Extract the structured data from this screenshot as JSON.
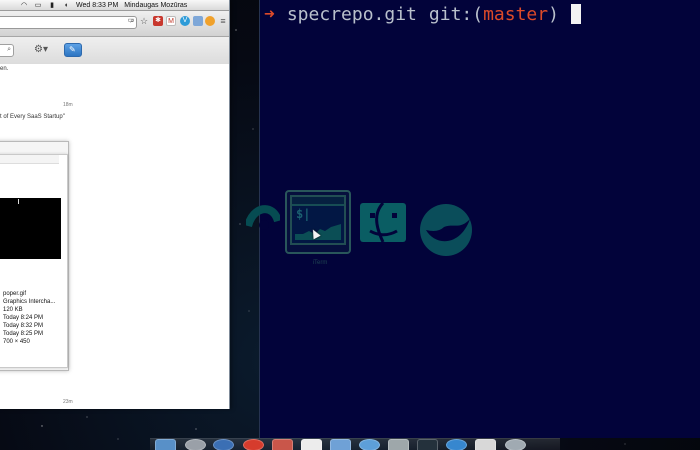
{
  "menubar": {
    "items": [
      "⎈",
      "⌂",
      "◫",
      "◐",
      "🔊"
    ],
    "time": "Wed 8:33 PM",
    "user": "Mindaugas Mozūras"
  },
  "left_window": {
    "address": "",
    "snippet": "en.",
    "timestamps": [
      "18m",
      "23m"
    ],
    "headline": "t of Every SaaS Startup\"",
    "file": {
      "name": "poper.gif",
      "kind": "Graphics Intercha...",
      "size": "120 KB",
      "created": "Today 8:24 PM",
      "modified": "Today 8:32 PM",
      "last_opened": "Today 8:25 PM",
      "dimensions": "700 × 450"
    }
  },
  "terminal": {
    "prompt_symbol": "➜",
    "directory": "specrepo.git",
    "git_prefix": "git:(",
    "branch": "master",
    "git_suffix": ")"
  },
  "app_switcher": {
    "selected_label": "iTerm",
    "apps": [
      "chrome-like-icon",
      "iterm-icon",
      "finder-icon",
      "bird-icon"
    ]
  },
  "dock": {
    "icons": [
      "finder-icon",
      "system-icon",
      "badge-icon",
      "chrome-icon",
      "calendar-icon",
      "notes-icon",
      "folder-icon",
      "safari-icon",
      "terminal-icon",
      "iterm-icon",
      "app-icon",
      "document-icon",
      "trash-icon"
    ]
  },
  "colors": {
    "terminal_bg": "#02033a",
    "prompt": "#dd4a29",
    "text": "#b9c0cc",
    "switcher_outline": "#29565a"
  }
}
